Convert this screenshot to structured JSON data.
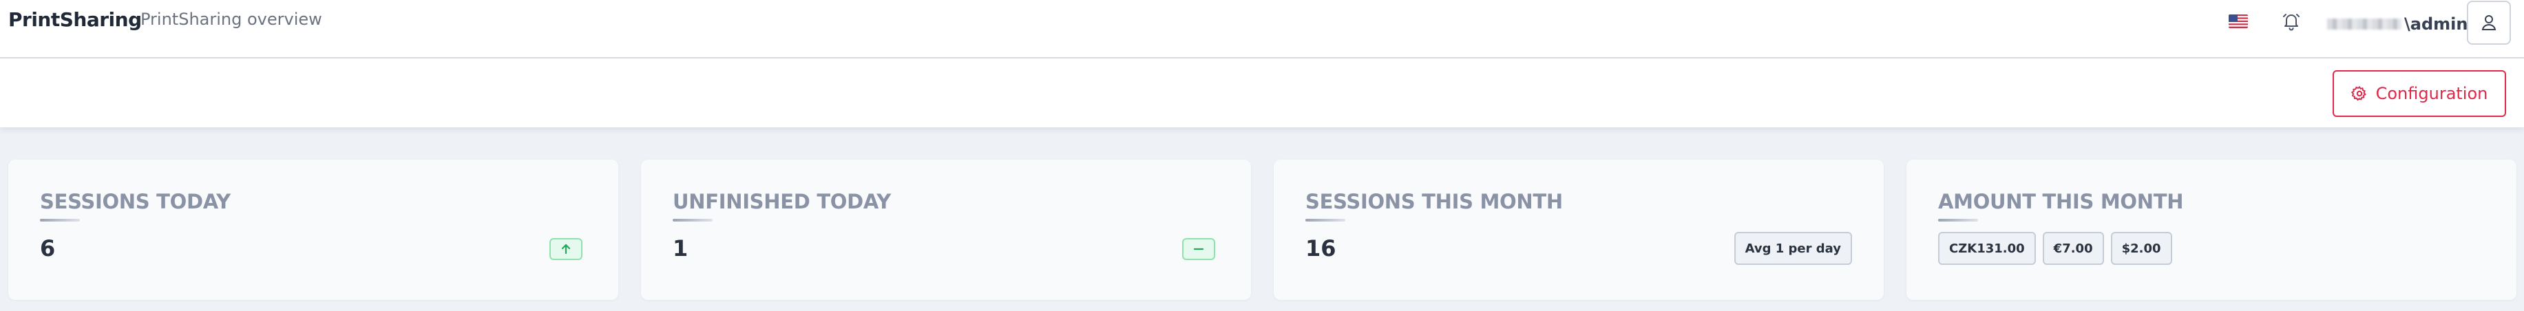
{
  "header": {
    "brand": "PrintSharing",
    "subtitle": "PrintSharing overview",
    "user_suffix": "\\admin"
  },
  "icons": {
    "language": "us-flag-icon",
    "notifications": "bell-icon",
    "account": "user-icon",
    "configuration": "gear-icon"
  },
  "toolbar": {
    "configuration_label": "Configuration"
  },
  "colors": {
    "accent": "#e0284a",
    "positive": "#22a95b",
    "card_title": "#8a93a6"
  },
  "cards": [
    {
      "title": "SESSIONS TODAY",
      "value": "6",
      "trend": "up"
    },
    {
      "title": "UNFINISHED TODAY",
      "value": "1",
      "trend": "neutral"
    },
    {
      "title": "SESSIONS THIS MONTH",
      "value": "16",
      "note": "Avg 1 per day"
    },
    {
      "title": "AMOUNT THIS MONTH",
      "amounts": [
        "CZK131.00",
        "€7.00",
        "$2.00"
      ]
    }
  ]
}
